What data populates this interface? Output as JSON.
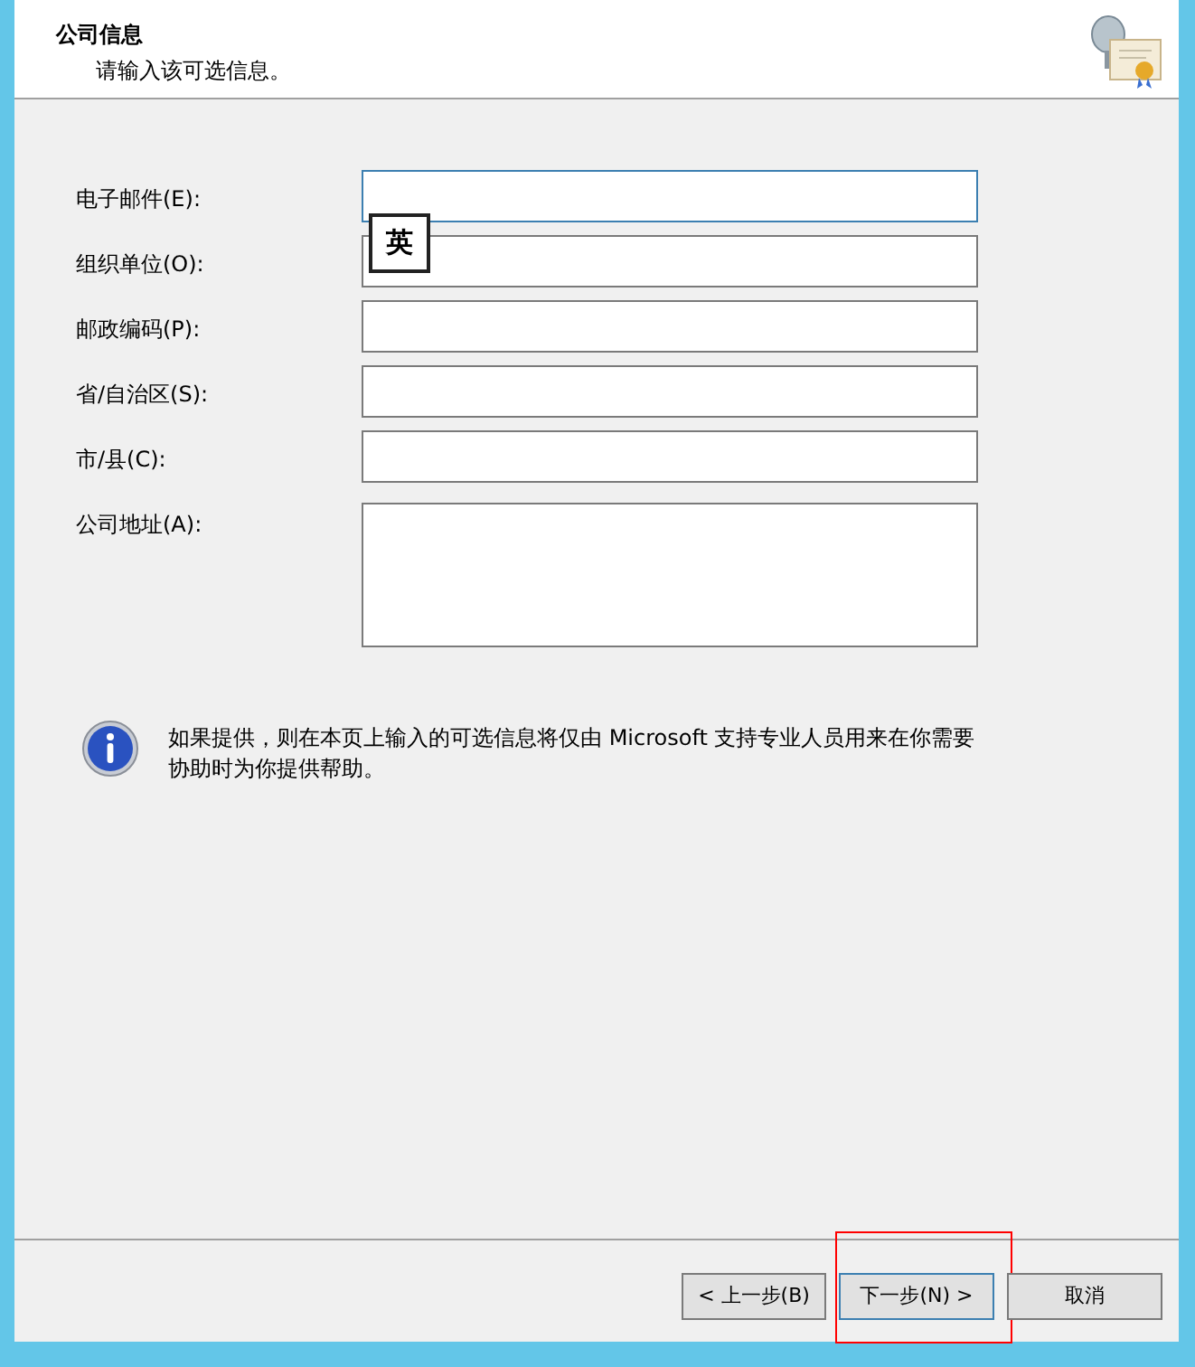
{
  "header": {
    "title": "公司信息",
    "subtitle": "请输入该可选信息。"
  },
  "fields": [
    {
      "label": "电子邮件(E):",
      "kind": "line",
      "focused": true
    },
    {
      "label": "组织单位(O):",
      "kind": "line",
      "focused": false
    },
    {
      "label": "邮政编码(P):",
      "kind": "line",
      "focused": false
    },
    {
      "label": "省/自治区(S):",
      "kind": "line",
      "focused": false
    },
    {
      "label": "市/县(C):",
      "kind": "line",
      "focused": false
    },
    {
      "label": "公司地址(A):",
      "kind": "multiline",
      "focused": false
    }
  ],
  "ime_indicator": "英",
  "info": "如果提供，则在本页上输入的可选信息将仅由 Microsoft 支持专业人员用来在你需要协助时为你提供帮助。",
  "buttons": [
    {
      "label": "< 上一步(B)",
      "default": false,
      "highlighted": false
    },
    {
      "label": "下一步(N) >",
      "default": true,
      "highlighted": true
    },
    {
      "label": "取消",
      "default": false,
      "highlighted": false
    }
  ]
}
